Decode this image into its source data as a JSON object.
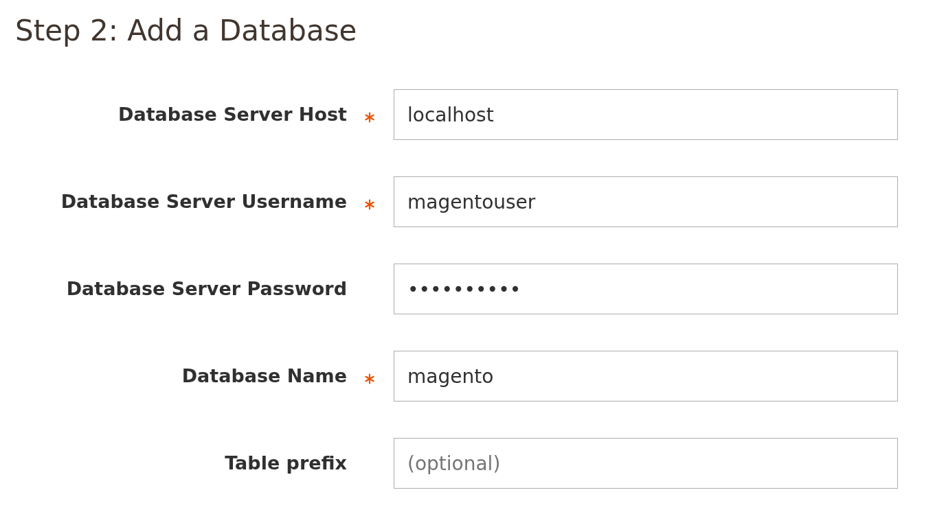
{
  "title": "Step 2: Add a Database",
  "fields": [
    {
      "label": "Database Server Host",
      "required": true,
      "value": "localhost"
    },
    {
      "label": "Database Server Username",
      "required": true,
      "value": "magentouser"
    },
    {
      "label": "Database Server Password",
      "required": false,
      "value": "••••••••••"
    },
    {
      "label": "Database Name",
      "required": true,
      "value": "magento"
    },
    {
      "label": "Table prefix",
      "required": false,
      "placeholder": "(optional)"
    }
  ]
}
